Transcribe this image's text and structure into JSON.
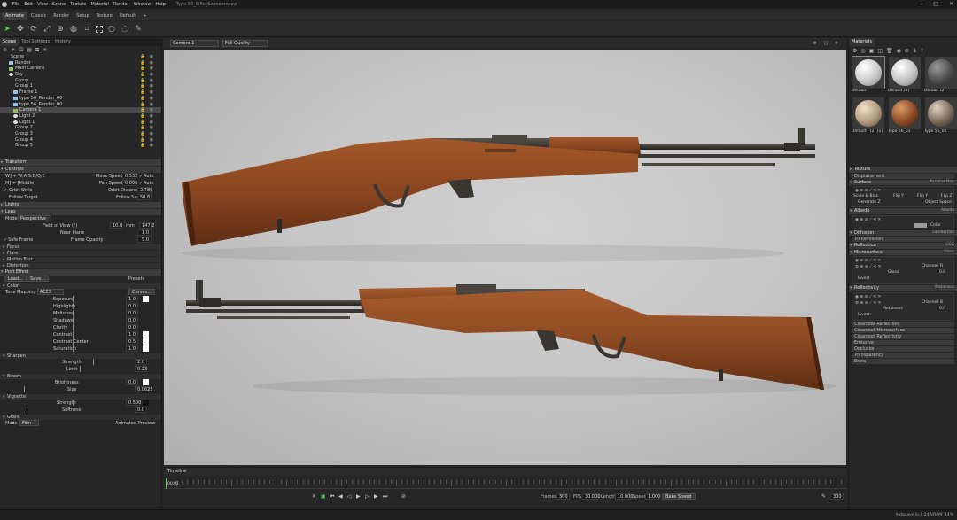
{
  "app": {
    "title": "Type 56_Rifle_Scene.mview",
    "menu": [
      "File",
      "Edit",
      "View",
      "Scene",
      "Texture",
      "Material",
      "Render",
      "Window",
      "Help"
    ],
    "window_controls": [
      "–",
      "□",
      "✕"
    ]
  },
  "workspace_tabs": [
    "Animate",
    "Classic",
    "Render",
    "Setup",
    "Texture",
    "Default",
    "+"
  ],
  "toolbar": {
    "tools": [
      "select-icon",
      "move-icon",
      "rotate-icon",
      "scale-icon",
      "snap-icon",
      "sphere-icon",
      "crop-icon",
      "box-select-icon",
      "circle-icon",
      "lasso-icon",
      "paint-select-icon"
    ]
  },
  "scene_panel": {
    "tabs": [
      "Scene",
      "Tool Settings",
      "History"
    ],
    "outline": [
      {
        "label": "Scene",
        "type": "folder",
        "indent": 1
      },
      {
        "label": "Render",
        "type": "obj",
        "indent": 2
      },
      {
        "label": "Main Camera",
        "type": "cam",
        "indent": 2
      },
      {
        "label": "Sky",
        "type": "lt",
        "indent": 2
      },
      {
        "label": "Group",
        "type": "folder",
        "indent": 2
      },
      {
        "label": "Group 1",
        "type": "folder",
        "indent": 2
      },
      {
        "label": "Frame 1",
        "type": "obj",
        "indent": 3
      },
      {
        "label": "type 56_Render_00",
        "type": "obj",
        "indent": 3
      },
      {
        "label": "type 56_Render_00",
        "type": "obj",
        "indent": 3
      },
      {
        "label": "Camera 1",
        "type": "cam",
        "indent": 3,
        "selected": true
      },
      {
        "label": "Light 2",
        "type": "lt",
        "indent": 3
      },
      {
        "label": "Light 1",
        "type": "lt",
        "indent": 3
      },
      {
        "label": "Group 2",
        "type": "folder",
        "indent": 2
      },
      {
        "label": "Group 3",
        "type": "folder",
        "indent": 2
      },
      {
        "label": "Group 4",
        "type": "folder",
        "indent": 2
      },
      {
        "label": "Group 5",
        "type": "folder",
        "indent": 2
      }
    ],
    "transform_label": "Transform",
    "controls_label": "Controls",
    "controls": {
      "wasd_label": "[W] + W,A,S,D/Q,E",
      "move_speed_label": "Move Speed",
      "move_speed": "0.532",
      "auto1": "Auto",
      "mmb_label": "[M] + [Middle]",
      "pan_speed_label": "Pan Speed",
      "pan_speed": "0.006",
      "auto2": "Auto",
      "orbit_style_label": "Orbit Style",
      "orbit_distance_label": "Orbit Distance",
      "orbit_distance": "2.789",
      "follow_target_label": "Follow Target",
      "follow_say_label": "Follow Say",
      "follow_say": "50.8"
    },
    "lights_label": "Lights",
    "lens_label": "Lens",
    "lens": {
      "mode_label": "Mode",
      "mode": "Perspective",
      "fov_label": "Field of View (°)",
      "fov": "10.0",
      "unit": "mm",
      "fov_mm": "147.2",
      "near_plane_label": "Near Plane",
      "near_plane": "1.0",
      "safe_frame_label": "Safe Frame",
      "frame_opacity_label": "Frame Opacity",
      "frame_opacity": "5.0"
    },
    "lens_subsections": [
      "Focus",
      "Flare",
      "Motion Blur",
      "Distortion"
    ],
    "post_effect_label": "Post Effect",
    "post_buttons": {
      "load": "Load...",
      "save": "Save...",
      "presets": "Presets"
    },
    "color_label": "Color",
    "color": {
      "tone_mapping_label": "Tone Mapping",
      "tone_mapping": "ACES",
      "curves": "Curves...",
      "rows": [
        {
          "label": "Exposure",
          "value": "1.0",
          "swatch": true
        },
        {
          "label": "Highlights",
          "value": "0.0"
        },
        {
          "label": "Midtones",
          "value": "0.0"
        },
        {
          "label": "Shadows",
          "value": "0.0"
        },
        {
          "label": "Clarity",
          "value": "0.0"
        },
        {
          "label": "Contrast",
          "value": "1.0",
          "swatch": true
        },
        {
          "label": "Contrast Center",
          "value": "0.5",
          "swatch": true
        },
        {
          "label": "Saturation",
          "value": "1.0",
          "swatch": true
        }
      ]
    },
    "sharpen_label": "Sharpen",
    "sharpen": {
      "strength_label": "Strength",
      "strength": "2.0",
      "limit_label": "Limit",
      "limit": "0.23"
    },
    "bloom_label": "Bloom",
    "bloom": {
      "brightness_label": "Brightness",
      "brightness": "0.0",
      "size_label": "Size",
      "size": "0.0625"
    },
    "vignette_label": "Vignette",
    "vignette": {
      "strength_label": "Strength",
      "strength": "0.500",
      "softness_label": "Softness",
      "softness": "0.0"
    },
    "grain_label": "Grain",
    "grain": {
      "mode_label": "Mode",
      "mode": "Film",
      "animated_label": "Animated Preview"
    }
  },
  "viewport": {
    "camera": "Camera 1",
    "quality": "Full Quality",
    "icons": [
      "⚙",
      "□",
      "✕"
    ]
  },
  "timeline": {
    "title": "Timeline",
    "frame": "00:01",
    "frames_label": "Frames",
    "frames": "300",
    "fps_label": "FPS",
    "fps": "30.000",
    "length_label": "Length",
    "length": "10.000",
    "speed_label": "Speed",
    "speed": "1.000",
    "bake_speed": "Bake Speed",
    "end_value": "300"
  },
  "materials_panel": {
    "tab": "Materials",
    "icons": [
      "⚙",
      "◎",
      "▣",
      "◫",
      "🗑",
      "◉",
      "⊙",
      "↓",
      "?"
    ],
    "materials": [
      {
        "name": "Default",
        "color": "radial-gradient(circle at 35% 30%,#ffffff,#c9c9c9 55%,#7d7d7d)",
        "selected": true
      },
      {
        "name": "Default (1)",
        "color": "radial-gradient(circle at 35% 30%,#ffffff,#c2c2c2 55%,#767676)"
      },
      {
        "name": "Default (2)",
        "color": "radial-gradient(circle at 35% 30%,#9a9a9a,#4d4d4d 55%,#1f1f1f)"
      },
      {
        "name": "Default - (2) (1)",
        "color": "radial-gradient(circle at 35% 30%,#f1e2c8,#b09b7e 55%,#5a4a38)"
      },
      {
        "name": "Type 56_01",
        "color": "radial-gradient(circle at 35% 30%,#d99a66,#8b4a24 55%,#3a1a08)"
      },
      {
        "name": "Type 56_02",
        "color": "radial-gradient(circle at 35% 30%,#e0d2c3,#7a6a5a 55%,#2a2220)"
      }
    ],
    "sections": {
      "texture": "Texture",
      "displacement": "Displacement",
      "surface": "Surface",
      "surface_val": "Parallax Map",
      "scale_bias": "Scale & Bias",
      "flip_y1": "Flip Y",
      "flip_y2": "Flip Y",
      "flip_z": "Flip Z",
      "generate_z": "Generate Z",
      "object_space": "Object Space",
      "albedo": "Albedo",
      "albedo_val": "Albedo",
      "color_label": "Color",
      "diffusion": "Diffusion",
      "diffusion_val": "Lambertian",
      "transmission": "Transmission",
      "reflection": "Reflection",
      "reflection_val": "GGX",
      "microsurface": "Microsurface",
      "microsurface_val": "Gloss",
      "channel_label": "Channel",
      "channel_r": "R",
      "gloss_label": "Gloss",
      "gloss": "0.0",
      "invert": "Invert",
      "reflectivity": "Reflectivity",
      "reflectivity_val": "Metalness",
      "channel_b": "B",
      "metalness_label": "Metalness",
      "metalness": "0.0",
      "invert2": "Invert",
      "collapsed": [
        "Clearcoat Reflection",
        "Clearcoat Microsurface",
        "Clearcoat Reflectivity",
        "Emissive",
        "Occlusion",
        "Transparency",
        "Extra"
      ]
    }
  },
  "statusbar": {
    "text": "Autosave in 0:24   VRAM: 14%"
  },
  "colors": {
    "accent": "#5bd15b",
    "panel": "#262626",
    "viewport_bg": "#c6c6c6",
    "wood": "#8a4a22",
    "steel": "#3d3a37"
  },
  "chart_data": null
}
